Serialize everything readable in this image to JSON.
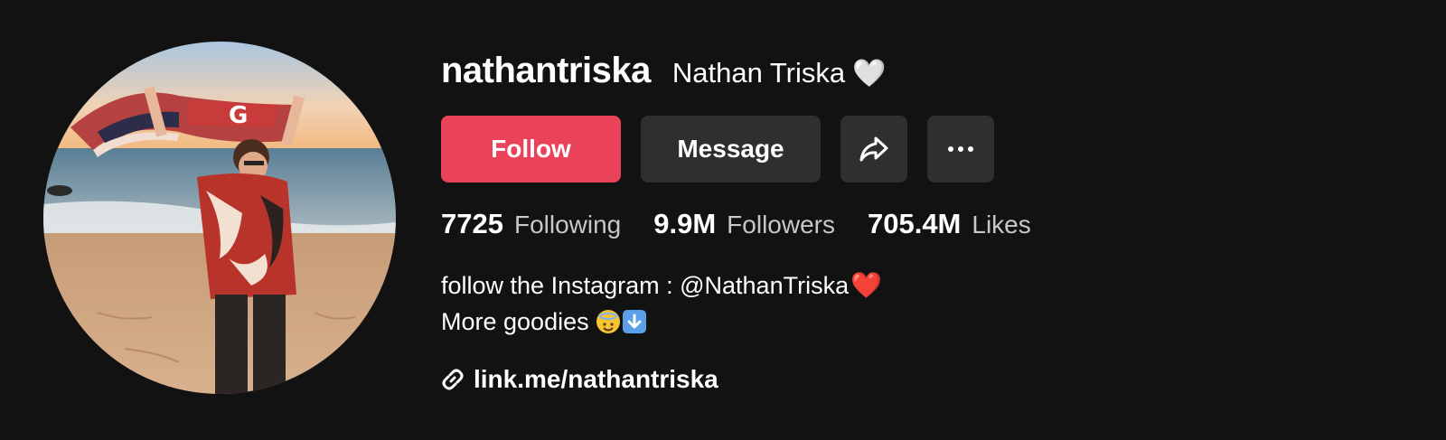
{
  "profile": {
    "username": "nathantriska",
    "display_name": "Nathan Triska",
    "display_badge": "🤍",
    "avatar_alt": "profile photo of man on beach holding flag"
  },
  "actions": {
    "follow_label": "Follow",
    "message_label": "Message",
    "share_icon": "share-icon",
    "more_icon": "more-icon"
  },
  "stats": [
    {
      "value": "7725",
      "label": "Following"
    },
    {
      "value": "9.9M",
      "label": "Followers"
    },
    {
      "value": "705.4M",
      "label": "Likes"
    }
  ],
  "bio": {
    "line1": "follow the Instagram : @NathanTriska",
    "line1_emoji": "❤️",
    "line2": "More goodies",
    "line2_emoji_1": "😇",
    "line2_emoji_2": "⬇️"
  },
  "link": {
    "text": "link.me/nathantriska",
    "icon": "link-icon"
  },
  "colors": {
    "background": "#121212",
    "follow": "#ea4359",
    "secondary_button": "#2f2f2f"
  }
}
